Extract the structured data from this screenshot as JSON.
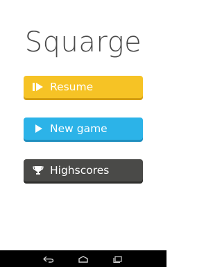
{
  "app": {
    "title": "Squarge"
  },
  "menu": {
    "resume": {
      "label": "Resume",
      "icon": "resume-icon",
      "color": "#f6c325"
    },
    "new_game": {
      "label": "New game",
      "icon": "play-icon",
      "color": "#2cb3e8"
    },
    "highscores": {
      "label": "Highscores",
      "icon": "trophy-icon",
      "color": "#4a4a48"
    }
  },
  "navigation_bar": {
    "buttons": [
      "back-icon",
      "home-icon",
      "recent-apps-icon"
    ]
  }
}
